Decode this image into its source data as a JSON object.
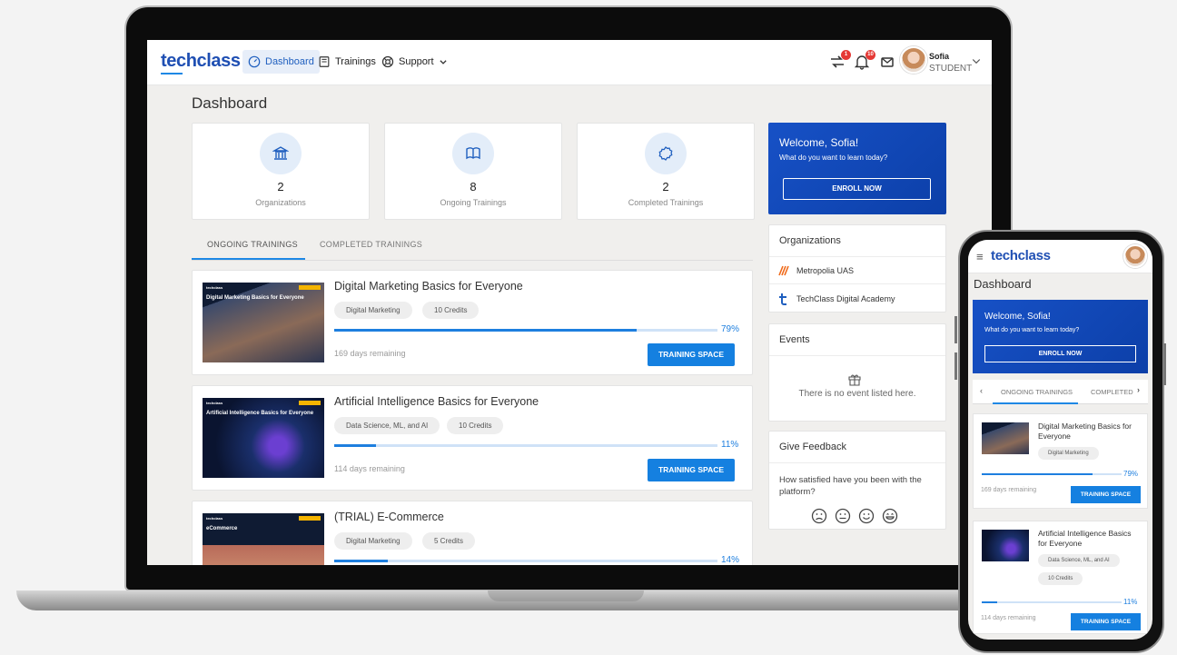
{
  "laptop": {
    "header": {
      "logo": "techclass",
      "nav": [
        {
          "label": "Dashboard",
          "active": true
        },
        {
          "label": "Trainings",
          "active": false
        },
        {
          "label": "Support",
          "active": false
        }
      ],
      "badges": {
        "switch": "1",
        "notifications": "10"
      },
      "user": {
        "name": "Sofia",
        "role": "STUDENT"
      }
    },
    "page_title": "Dashboard",
    "stats": [
      {
        "value": "2",
        "label": "Organizations",
        "icon": "bank-icon"
      },
      {
        "value": "8",
        "label": "Ongoing Trainings",
        "icon": "book-icon"
      },
      {
        "value": "2",
        "label": "Completed Trainings",
        "icon": "badge-icon"
      }
    ],
    "tabs": [
      "ONGOING TRAININGS",
      "COMPLETED TRAININGS"
    ],
    "trainings": [
      {
        "title": "Digital Marketing Basics for Everyone",
        "tags": [
          "Digital Marketing",
          "10 Credits"
        ],
        "progress": 79,
        "progress_label": "79%",
        "remaining": "169 days remaining",
        "button": "TRAINING SPACE",
        "thumb_brand": "techclass",
        "thumb_title": "Digital Marketing Basics for Everyone"
      },
      {
        "title": "Artificial Intelligence Basics for Everyone",
        "tags": [
          "Data Science, ML, and AI",
          "10 Credits"
        ],
        "progress": 11,
        "progress_label": "11%",
        "remaining": "114 days remaining",
        "button": "TRAINING SPACE",
        "thumb_brand": "techclass",
        "thumb_title": "Artificial Intelligence Basics for Everyone"
      },
      {
        "title": "(TRIAL) E-Commerce",
        "tags": [
          "Digital Marketing",
          "5 Credits"
        ],
        "progress": 14,
        "progress_label": "14%",
        "thumb_brand": "techclass",
        "thumb_title": "eCommerce"
      }
    ],
    "welcome": {
      "title": "Welcome, Sofia!",
      "subtitle": "What do you want to learn today?",
      "button": "ENROLL NOW"
    },
    "organizations": {
      "title": "Organizations",
      "items": [
        "Metropolia UAS",
        "TechClass Digital Academy"
      ]
    },
    "events": {
      "title": "Events",
      "empty": "There is no event listed here."
    },
    "feedback": {
      "title": "Give Feedback",
      "question": "How satisfied have you been with the platform?"
    }
  },
  "phone": {
    "logo": "techclass",
    "page_title": "Dashboard",
    "welcome": {
      "title": "Welcome, Sofia!",
      "subtitle": "What do you want to learn today?",
      "button": "ENROLL NOW"
    },
    "tabs": [
      "ONGOING TRAININGS",
      "COMPLETED"
    ],
    "trainings": [
      {
        "title": "Digital Marketing Basics for Everyone",
        "tags": [
          "Digital Marketing"
        ],
        "progress": 79,
        "progress_label": "79%",
        "remaining": "169 days remaining",
        "button": "TRAINING SPACE"
      },
      {
        "title": "Artificial Intelligence Basics for Everyone",
        "tags": [
          "Data Science, ML, and AI",
          "10 Credits"
        ],
        "progress": 11,
        "progress_label": "11%",
        "remaining": "114 days remaining",
        "button": "TRAINING SPACE"
      }
    ]
  },
  "colors": {
    "brand": "#1f4fb3",
    "accent": "#1580e0",
    "progress_track": "#cfe2f7",
    "badge": "#e53935"
  }
}
